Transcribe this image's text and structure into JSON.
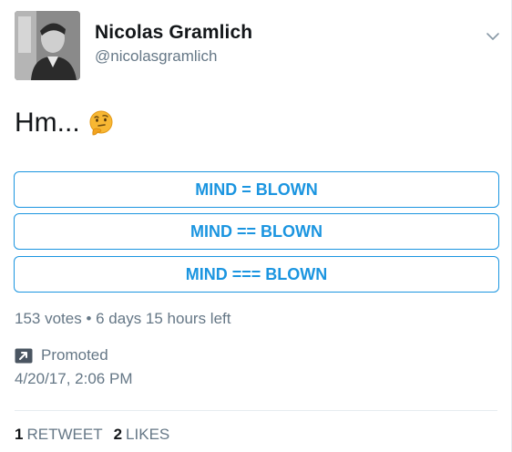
{
  "user": {
    "name": "Nicolas Gramlich",
    "handle": "@nicolasgramlich"
  },
  "tweet": {
    "text": "Hm...",
    "emoji": "thinking-face"
  },
  "poll": {
    "options": [
      "MIND = BLOWN",
      "MIND == BLOWN",
      "MIND === BLOWN"
    ],
    "meta": "153 votes • 6 days 15 hours left"
  },
  "promoted": {
    "label": "Promoted",
    "icon": "promoted-arrow-icon"
  },
  "timestamp": "4/20/17, 2:06 PM",
  "stats": {
    "retweets_count": "1",
    "retweets_label": "RETWEET",
    "likes_count": "2",
    "likes_label": "LIKES"
  },
  "colors": {
    "accent": "#1b95e0",
    "secondary_text": "#657786",
    "primary_text": "#14171a"
  }
}
